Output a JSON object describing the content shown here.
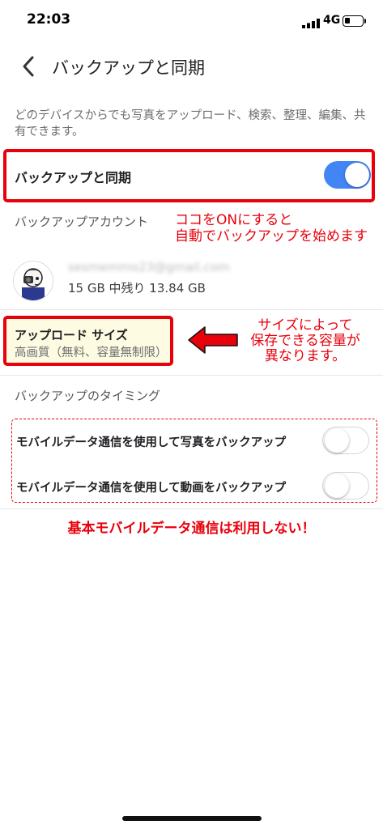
{
  "status_bar": {
    "time": "22:03",
    "network": "4G"
  },
  "header": {
    "title": "バックアップと同期"
  },
  "description": "どのデバイスからでも写真をアップロード、検索、整理、編集、共有できます。",
  "sync": {
    "label": "バックアップと同期",
    "enabled": true,
    "toggle_color": "#4285f4"
  },
  "account": {
    "section_title": "バックアップアカウント",
    "email": "sesmemmo23@gmail.com",
    "storage": "15 GB 中残り 13.84 GB"
  },
  "upload_size": {
    "title": "アップロード サイズ",
    "value": "高画質（無料、容量無制限）"
  },
  "timing": {
    "section_title": "バックアップのタイミング",
    "rows": [
      {
        "label": "モバイルデータ通信を使用して写真をバックアップ",
        "enabled": false
      },
      {
        "label": "モバイルデータ通信を使用して動画をバックアップ",
        "enabled": false
      }
    ]
  },
  "annotations": {
    "sync_note": [
      "ココをONにすると",
      "自動でバックアップを始めます"
    ],
    "size_note": [
      "サイズによって",
      "保存できる容量が",
      "異なります。"
    ],
    "mobile_note": "基本モバイルデータ通信は利用しない！",
    "color": "#e8000b"
  },
  "icons": [
    "back-arrow-icon",
    "signal-icon",
    "battery-icon",
    "avatar-icon",
    "red-arrow-icon"
  ]
}
